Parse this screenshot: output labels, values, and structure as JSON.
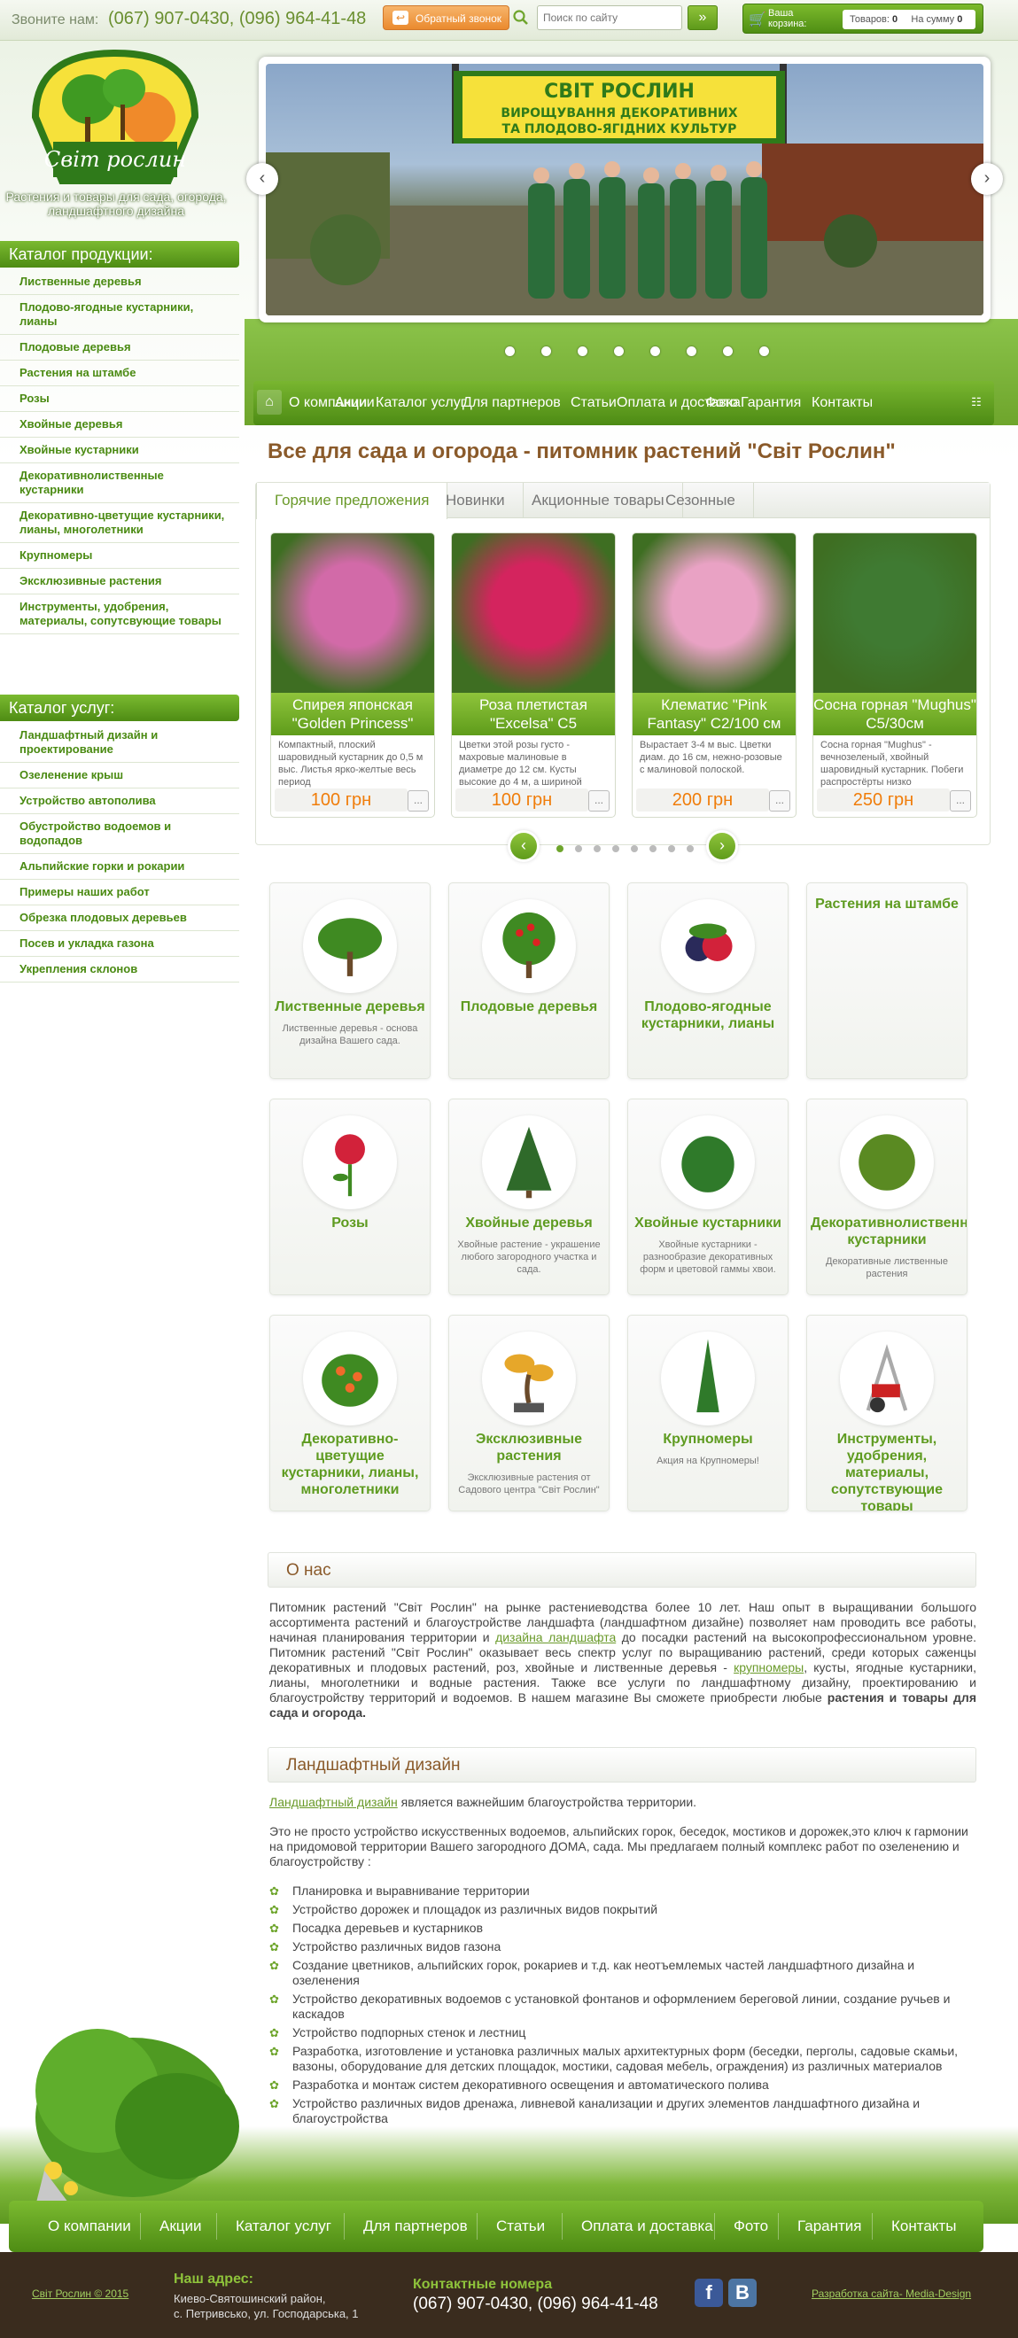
{
  "header": {
    "phone_label": "Звоните нам:",
    "phones": "(067) 907-0430, (096) 964-41-48",
    "callback_label": "Обратный звонок",
    "search_placeholder": "Поиск по сайту",
    "search_button": "»",
    "cart": {
      "title": "Ваша корзина:",
      "items_label": "Товаров:",
      "items_count": "0",
      "sum_label": "На сумму",
      "sum_value": "0"
    }
  },
  "logo": {
    "text": "Світ рослин"
  },
  "tagline": "Растения и товары для сада, огорода, ландшафтного дизайна",
  "slider": {
    "sign_line1": "СВІТ РОСЛИН",
    "sign_line2": "ВИРОЩУВАННЯ ДЕКОРАТИВНИХ",
    "sign_line3": "ТА ПЛОДОВО-ЯГІДНИХ КУЛЬТУР",
    "dots": 8,
    "active": 0
  },
  "nav": {
    "items": [
      "О компании",
      "Акции",
      "Каталог услуг",
      "Для партнеров",
      "Статьи",
      "Оплата и доставка",
      "Фото",
      "Гарантия",
      "Контакты"
    ]
  },
  "sidebar": {
    "products_head": "Каталог продукции:",
    "products": [
      "Лиственные деревья",
      "Плодово-ягодные кустарники, лианы",
      "Плодовые деревья",
      "Растения на штамбе",
      "Розы",
      "Хвойные деревья",
      "Хвойные кустарники",
      "Декоративнолиственные кустарники",
      "Декоративно-цветущие кустарники, лианы, многолетники",
      "Крупномеры",
      "Эксклюзивные растения",
      "Инструменты, удобрения, материалы, сопутсвующие товары"
    ],
    "services_head": "Каталог услуг:",
    "services": [
      "Ландшафтный дизайн и проектирование",
      "Озеленение крыш",
      "Устройство автополива",
      "Обустройство водоемов и водопадов",
      "Альпийские горки и рокарии",
      "Примеры наших работ",
      "Обрезка плодовых деревьев",
      "Посев и укладка газона",
      "Укрепления склонов"
    ]
  },
  "main": {
    "title": "Все для сада и огорода - питомник растений \"Світ Рослин\"",
    "tabs": [
      "Горячие предложения",
      "Новинки",
      "Акционные товары",
      "Сезонные"
    ],
    "products": [
      {
        "name": "Спирея японская \"Golden Princess\"",
        "desc": "Компактный, плоский шаровидный кустарник до 0,5 м выс. Листья ярко-желтые весь период",
        "price": "100 грн",
        "color": "#d26aa8"
      },
      {
        "name": "Роза плетистая \"Excelsa\" C5",
        "desc": "Цветки этой розы густо - махровые малиновые в диаметре до 12 см. Кусты высокие до 4 м, а шириной",
        "price": "100 грн",
        "color": "#d4245e"
      },
      {
        "name": "Клематис \"Pink Fantasy\" C2/100 см",
        "desc": "Вырастает 3-4 м выс. Цветки диам. до 16 см, нежно-розовые с малиновой полоской.",
        "price": "200 грн",
        "color": "#e9a2c4"
      },
      {
        "name": "Сосна горная \"Mughus\" C5/30см",
        "desc": "Сосна горная \"Mughus\" - вечнозеленый, хвойный шаровидный кустарник. Побеги распростёрты низко",
        "price": "250 грн",
        "color": "#3f7a32"
      }
    ],
    "more_label": "...",
    "carousel_dots": 8,
    "categories": [
      {
        "title": "Лиственные деревья",
        "desc": "Лиственные деревья - основа дизайна Вашего сада."
      },
      {
        "title": "Плодовые деревья",
        "desc": ""
      },
      {
        "title": "Плодово-ягодные кустарники, лианы",
        "desc": ""
      },
      {
        "title": "Растения на штамбе",
        "desc": ""
      },
      {
        "title": "Розы",
        "desc": ""
      },
      {
        "title": "Хвойные деревья",
        "desc": "Хвойные растение - украшение любого загородного участка и сада."
      },
      {
        "title": "Хвойные кустарники",
        "desc": "Хвойные кустарники - разнообразие декоративных форм и цветовой гаммы хвои."
      },
      {
        "title": "Декоративнолиственные кустарники",
        "desc": "Декоративные лиственные растения"
      },
      {
        "title": "Декоративно-цветущие кустарники, лианы, многолетники",
        "desc": ""
      },
      {
        "title": "Эксклюзивные растения",
        "desc": "Эксклюзивные растения от Садового центра \"Світ Рослин\""
      },
      {
        "title": "Крупномеры",
        "desc": "Акция на Крупномеры!"
      },
      {
        "title": "Инструменты, удобрения, материалы, сопутствующие товары",
        "desc": ""
      }
    ]
  },
  "about": {
    "head": "О нас",
    "p1": "Питомник растений \"Світ Рослин\" на рынке растениеводства более 10 лет. Наш опыт в выращивании большого ассортимента растений и благоустройстве ландшафта (ландшафтном дизайне) позволяет нам проводить все работы, начиная планирования территории и",
    "link1": "дизайна ландшафта",
    "p2": "до посадки растений на высокопрофессиональном уровне. Питомник растений \"Світ Рослин\" оказывает весь спектр услуг по выращиванию растений, среди которых саженцы декоративных и плодовых растений, роз, хвойные и лиственные деревья -",
    "link2": "крупномеры",
    "p3": ", кусты, ягодные кустарники, лианы, многолетники и водные растения. Также все услуги по ландшафтному дизайну, проектированию и благоустройству территорий и водоемов. В нашем магазине Вы сможете приобрести любые",
    "bold": "растения и товары  для сада и огорода."
  },
  "landscape": {
    "head": "Ландшафтный дизайн",
    "link": "Ландшафтный дизайн",
    "intro_rest": " является важнейшим  благоустройства территории.",
    "p2": "Это не просто устройство искусственных водоемов, альпийских горок, беседок, мостиков и дорожек,это ключ к гармонии на придомовой территории Вашего загородного ДОМА, сада. Мы предлагаем полный комплекс работ по озеленению и благоустройству :",
    "list": [
      "Планировка и выравнивание территории",
      "Устройство дорожек и площадок из различных видов покрытий",
      "Посадка деревьев и кустарников",
      "Устройство различных видов газона",
      "Создание цветников, альпийских горок, рокариев и т.д. как неотъемлемых частей ландшафтного дизайна и озеленения",
      "Устройство декоративных водоемов с установкой фонтанов и оформлением береговой линии, создание ручьев и каскадов",
      "Устройство подпорных стенок и лестниц",
      "Разработка, изготовление и установка различных малых архитектурных форм (беседки, перголы, садовые скамьи, вазоны, оборудование для детских площадок, мостики, садовая мебель, ограждения) из различных материалов",
      "Разработка и монтаж систем декоративного освещения и автоматического полива",
      "Устройство различных видов дренажа, ливневой канализации и других элементов ландшафтного дизайна и благоустройства"
    ]
  },
  "footer_nav": [
    "О компании",
    "Акции",
    "Каталог услуг",
    "Для партнеров",
    "Статьи",
    "Оплата и доставка",
    "Фото",
    "Гарантия",
    "Контакты"
  ],
  "footer": {
    "copyright": "Світ Рослин © 2015",
    "address_head": "Наш адрес:",
    "address_line1": "Киево-Святошинский район,",
    "address_line2": "с. Петривсько, ул. Господарська, 1",
    "phones_head": "Контактные номера",
    "phones": "(067) 907-0430, (096) 964-41-48",
    "developer": "Разработка сайта- Media-Design"
  }
}
